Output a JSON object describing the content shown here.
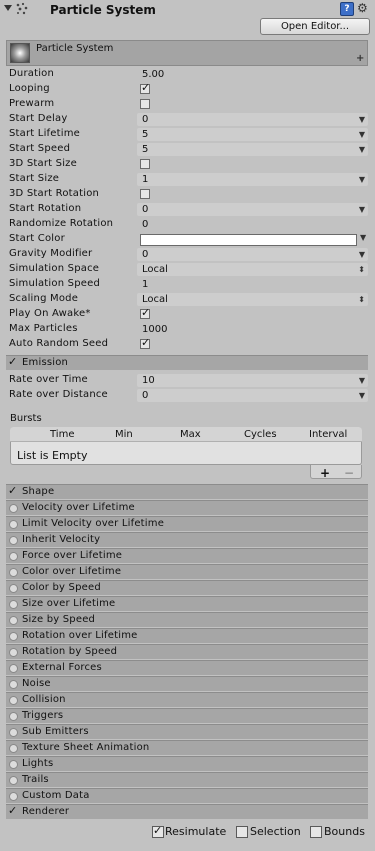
{
  "header": {
    "title": "Particle System",
    "open_editor": "Open Editor...",
    "help_glyph": "?"
  },
  "main": {
    "title": "Particle System",
    "rows": [
      {
        "label": "Duration",
        "value": "5.00",
        "type": "plain"
      },
      {
        "label": "Looping",
        "checked": true,
        "type": "check"
      },
      {
        "label": "Prewarm",
        "checked": false,
        "type": "check"
      },
      {
        "label": "Start Delay",
        "value": "0",
        "type": "dropdown"
      },
      {
        "label": "Start Lifetime",
        "value": "5",
        "type": "dropdown"
      },
      {
        "label": "Start Speed",
        "value": "5",
        "type": "dropdown"
      },
      {
        "label": "3D Start Size",
        "checked": false,
        "type": "check"
      },
      {
        "label": "Start Size",
        "value": "1",
        "type": "dropdown"
      },
      {
        "label": "3D Start Rotation",
        "checked": false,
        "type": "check"
      },
      {
        "label": "Start Rotation",
        "value": "0",
        "type": "dropdown"
      },
      {
        "label": "Randomize Rotation",
        "value": "0",
        "type": "plain"
      },
      {
        "label": "Start Color",
        "color": "#ffffff",
        "type": "color"
      },
      {
        "label": "Gravity Modifier",
        "value": "0",
        "type": "dropdown"
      },
      {
        "label": "Simulation Space",
        "value": "Local",
        "type": "select"
      },
      {
        "label": "Simulation Speed",
        "value": "1",
        "type": "plain"
      },
      {
        "label": "Scaling Mode",
        "value": "Local",
        "type": "select"
      },
      {
        "label": "Play On Awake*",
        "checked": true,
        "type": "check"
      },
      {
        "label": "Max Particles",
        "value": "1000",
        "type": "plain"
      },
      {
        "label": "Auto Random Seed",
        "checked": true,
        "type": "check"
      }
    ]
  },
  "emission": {
    "title": "Emission",
    "enabled": true,
    "rows": [
      {
        "label": "Rate over Time",
        "value": "10"
      },
      {
        "label": "Rate over Distance",
        "value": "0"
      }
    ],
    "bursts_label": "Bursts",
    "bursts_columns": [
      "Time",
      "Min",
      "Max",
      "Cycles",
      "Interval"
    ],
    "empty_text": "List is Empty",
    "add_glyph": "+",
    "remove_glyph": "−"
  },
  "modules": [
    {
      "label": "Shape",
      "enabled": true
    },
    {
      "label": "Velocity over Lifetime",
      "enabled": false
    },
    {
      "label": "Limit Velocity over Lifetime",
      "enabled": false
    },
    {
      "label": "Inherit Velocity",
      "enabled": false
    },
    {
      "label": "Force over Lifetime",
      "enabled": false
    },
    {
      "label": "Color over Lifetime",
      "enabled": false
    },
    {
      "label": "Color by Speed",
      "enabled": false
    },
    {
      "label": "Size over Lifetime",
      "enabled": false
    },
    {
      "label": "Size by Speed",
      "enabled": false
    },
    {
      "label": "Rotation over Lifetime",
      "enabled": false
    },
    {
      "label": "Rotation by Speed",
      "enabled": false
    },
    {
      "label": "External Forces",
      "enabled": false
    },
    {
      "label": "Noise",
      "enabled": false
    },
    {
      "label": "Collision",
      "enabled": false
    },
    {
      "label": "Triggers",
      "enabled": false
    },
    {
      "label": "Sub Emitters",
      "enabled": false
    },
    {
      "label": "Texture Sheet Animation",
      "enabled": false
    },
    {
      "label": "Lights",
      "enabled": false
    },
    {
      "label": "Trails",
      "enabled": false
    },
    {
      "label": "Custom Data",
      "enabled": false
    },
    {
      "label": "Renderer",
      "enabled": true
    }
  ],
  "footer": {
    "resimulate": {
      "label": "Resimulate",
      "checked": true
    },
    "selection": {
      "label": "Selection",
      "checked": false
    },
    "bounds": {
      "label": "Bounds",
      "checked": false
    }
  }
}
